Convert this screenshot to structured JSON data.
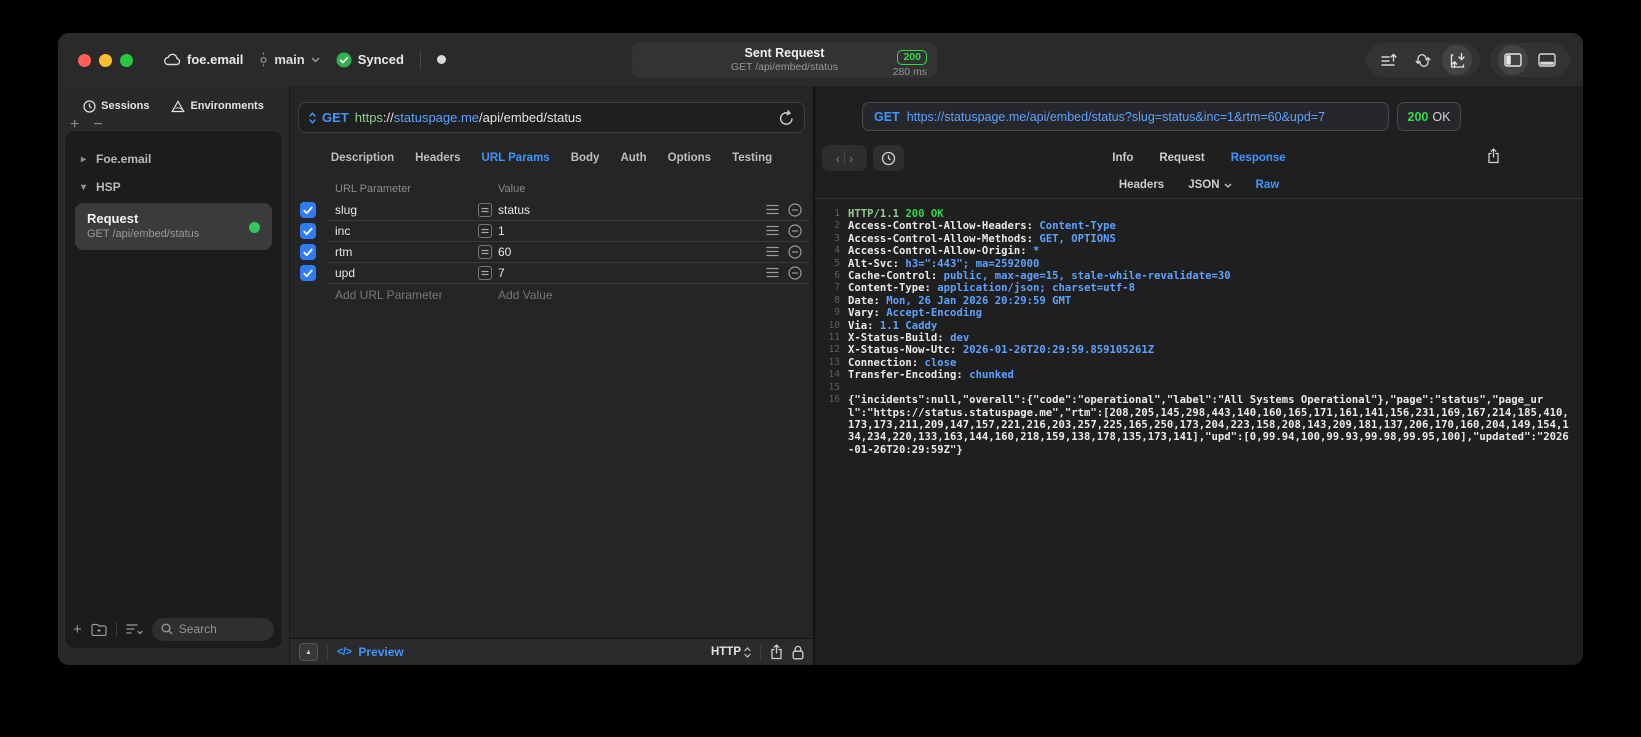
{
  "colors": {
    "accent_blue": "#3e95ff",
    "value_blue": "#5ca2ff",
    "status_green": "#32d74b",
    "header_green": "#8fcf8f",
    "traffic_red": "#ff5f57",
    "traffic_yellow": "#febc2e",
    "traffic_green": "#28c840"
  },
  "titlebar": {
    "project": "foe.email",
    "branch": "main",
    "sync_status": "Synced",
    "request_title": "Sent Request",
    "request_subtitle": "GET /api/embed/status",
    "status_code": "200",
    "duration": "280 ms"
  },
  "sidebar": {
    "tabs": [
      {
        "label": "Sessions"
      },
      {
        "label": "Environments"
      }
    ],
    "tree": [
      {
        "label": "Foe.email",
        "expanded": false
      },
      {
        "label": "HSP",
        "expanded": true
      }
    ],
    "request_item": {
      "title": "Request",
      "subtitle": "GET /api/embed/status"
    },
    "search_placeholder": "Search"
  },
  "editor": {
    "method": "GET",
    "url_parts": {
      "scheme": "https",
      "sep": "://",
      "host": "statuspage.me",
      "path": "/api/embed/status"
    },
    "tabs": [
      "Description",
      "Headers",
      "URL Params",
      "Body",
      "Auth",
      "Options",
      "Testing"
    ],
    "active_tab": "URL Params",
    "columns": {
      "name": "URL Parameter",
      "value": "Value"
    },
    "params": [
      {
        "name": "slug",
        "value": "status",
        "checked": true
      },
      {
        "name": "inc",
        "value": "1",
        "checked": true
      },
      {
        "name": "rtm",
        "value": "60",
        "checked": true
      },
      {
        "name": "upd",
        "value": "7",
        "checked": true
      }
    ],
    "add_param_label": "Add URL Parameter",
    "add_value_label": "Add Value",
    "footer": {
      "preview_icon": "</>",
      "preview_label": "Preview",
      "protocol": "HTTP"
    }
  },
  "response": {
    "method": "GET",
    "url": "https://statuspage.me/api/embed/status?slug=status&inc=1&rtm=60&upd=7",
    "status_code": "200",
    "status_text": "OK",
    "tabs": [
      "Info",
      "Request",
      "Response"
    ],
    "active_tab": "Response",
    "subtabs": [
      {
        "label": "Headers",
        "dropdown": false
      },
      {
        "label": "JSON",
        "dropdown": true
      },
      {
        "label": "Raw",
        "dropdown": false
      }
    ],
    "active_subtab": "Raw",
    "lines": [
      {
        "n": "1",
        "parts": [
          [
            "HTTP/1.1 ",
            "g"
          ],
          [
            "200 OK",
            "gb"
          ]
        ]
      },
      {
        "n": "2",
        "parts": [
          [
            "Access-Control-Allow-Headers: ",
            "k"
          ],
          [
            "Content-Type",
            "v"
          ]
        ]
      },
      {
        "n": "3",
        "parts": [
          [
            "Access-Control-Allow-Methods: ",
            "k"
          ],
          [
            "GET, OPTIONS",
            "v"
          ]
        ]
      },
      {
        "n": "4",
        "parts": [
          [
            "Access-Control-Allow-Origin: ",
            "k"
          ],
          [
            "*",
            "v"
          ]
        ]
      },
      {
        "n": "5",
        "parts": [
          [
            "Alt-Svc: ",
            "k"
          ],
          [
            "h3=\":443\"; ma=2592000",
            "v"
          ]
        ]
      },
      {
        "n": "6",
        "parts": [
          [
            "Cache-Control: ",
            "k"
          ],
          [
            "public, max-age=15, stale-while-revalidate=30",
            "v"
          ]
        ]
      },
      {
        "n": "7",
        "parts": [
          [
            "Content-Type: ",
            "k"
          ],
          [
            "application/json; charset=utf-8",
            "v"
          ]
        ]
      },
      {
        "n": "8",
        "parts": [
          [
            "Date: ",
            "k"
          ],
          [
            "Mon, 26 Jan 2026 20:29:59 GMT",
            "v"
          ]
        ]
      },
      {
        "n": "9",
        "parts": [
          [
            "Vary: ",
            "k"
          ],
          [
            "Accept-Encoding",
            "v"
          ]
        ]
      },
      {
        "n": "10",
        "parts": [
          [
            "Via: ",
            "k"
          ],
          [
            "1.1 Caddy",
            "v"
          ]
        ]
      },
      {
        "n": "11",
        "parts": [
          [
            "X-Status-Build: ",
            "k"
          ],
          [
            "dev",
            "v"
          ]
        ]
      },
      {
        "n": "12",
        "parts": [
          [
            "X-Status-Now-Utc: ",
            "k"
          ],
          [
            "2026-01-26T20:29:59.859105261Z",
            "v"
          ]
        ]
      },
      {
        "n": "13",
        "parts": [
          [
            "Connection: ",
            "k"
          ],
          [
            "close",
            "v"
          ]
        ]
      },
      {
        "n": "14",
        "parts": [
          [
            "Transfer-Encoding: ",
            "k"
          ],
          [
            "chunked",
            "v"
          ]
        ]
      },
      {
        "n": "15",
        "parts": []
      },
      {
        "n": "16",
        "parts": [
          [
            "{\"incidents\":null,\"overall\":{\"code\":\"operational\",\"label\":\"All Systems Operational\"},\"page\":\"status\",\"page_url\":\"https://status.statuspage.me\",\"rtm\":[208,205,145,298,443,140,160,165,171,161,141,156,231,169,167,214,185,410,173,173,211,209,147,157,221,216,203,257,225,165,250,173,204,223,158,208,143,209,181,137,206,170,160,204,149,154,134,234,220,133,163,144,160,218,159,138,178,135,173,141],\"upd\":[0,99.94,100,99.93,99.98,99.95,100],\"updated\":\"2026-01-26T20:29:59Z\"}",
            "k"
          ]
        ]
      }
    ]
  }
}
